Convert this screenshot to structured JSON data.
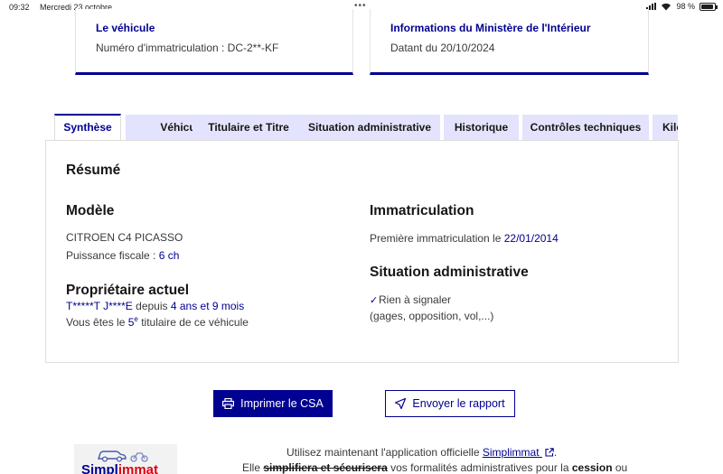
{
  "status_bar": {
    "time": "09:32",
    "date": "Mercredi 23 octobre",
    "battery": "98 %",
    "battery_level": 0.98
  },
  "cards": {
    "vehicle": {
      "title": "Le véhicule",
      "text": "Numéro d'immatriculation : DC-2**-KF"
    },
    "ministry": {
      "title": "Informations du Ministère de l'Intérieur",
      "text": "Datant du 20/10/2024"
    }
  },
  "tabs": [
    {
      "label": "Synthèse",
      "active": true
    },
    {
      "label": "Véhicule"
    },
    {
      "label": "Titulaire et Titre"
    },
    {
      "label": "Situation administrative"
    },
    {
      "label": "Historique"
    },
    {
      "label": "Contrôles techniques"
    },
    {
      "label": "Kilométrage"
    }
  ],
  "summary": {
    "title": "Résumé",
    "model": {
      "heading": "Modèle",
      "name": "CITROEN C4 PICASSO",
      "fiscal_label": "Puissance fiscale : ",
      "fiscal_value": "6 ch"
    },
    "owner": {
      "heading": "Propriétaire actuel",
      "name": "T*****T J****E",
      "since_label": " depuis ",
      "since_value": "4 ans et 9 mois",
      "rank_prefix": "Vous êtes le ",
      "rank_number": "5",
      "rank_sup": "e",
      "rank_suffix": " titulaire de ce véhicule"
    },
    "registration": {
      "heading": "Immatriculation",
      "first_label": "Première immatriculation le ",
      "first_date": "22/01/2014"
    },
    "admin": {
      "heading": "Situation administrative",
      "status": "Rien à signaler",
      "details": "(gages, opposition, vol,...)"
    }
  },
  "buttons": {
    "print": "Imprimer le CSA",
    "send": "Envoyer le rapport"
  },
  "bottom": {
    "logo_text_1": "Simpl",
    "logo_text_2": "immat",
    "line1_prefix": "Utilisez maintenant l'application officielle ",
    "line1_link": "Simplimmat",
    "line1_suffix": ".",
    "line2_prefix": "Elle ",
    "line2_strike": "simplifiera et sécurisera",
    "line2_middle": " vos formalités administratives pour la ",
    "line2_bold": "cession",
    "line2_suffix": " ou"
  }
}
